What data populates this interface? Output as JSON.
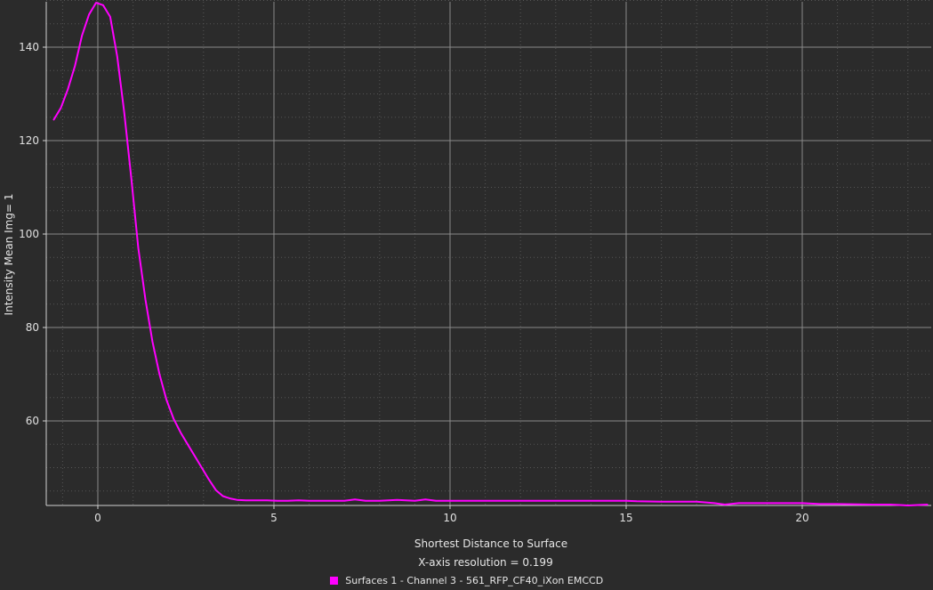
{
  "colors": {
    "background": "#2b2b2b",
    "series": "#ff00ff",
    "grid_major": "#8a8a8a",
    "grid_minor": "#555555",
    "text": "#e6e6e6"
  },
  "chart_data": {
    "type": "line",
    "xlabel": "Shortest Distance to Surface",
    "ylabel": "Intensity Mean Img= 1",
    "subtitle": "X-axis resolution = 0.199",
    "xlim": [
      -1.3,
      23.6
    ],
    "ylim": [
      41.5,
      150
    ],
    "xticks": [
      0,
      5,
      10,
      15,
      20
    ],
    "yticks": [
      60,
      80,
      100,
      120,
      140
    ],
    "grid": true,
    "legend_position": "bottom",
    "series": [
      {
        "name": "Surfaces 1 - Channel 3 - 561_RFP_CF40_iXon EMCCD",
        "color": "#ff00ff",
        "x": [
          -1.25,
          -1.05,
          -0.85,
          -0.65,
          -0.45,
          -0.25,
          -0.05,
          0.15,
          0.35,
          0.55,
          0.75,
          0.95,
          1.15,
          1.35,
          1.55,
          1.75,
          1.95,
          2.15,
          2.35,
          2.55,
          2.75,
          2.95,
          3.15,
          3.35,
          3.55,
          3.75,
          3.95,
          4.2,
          4.5,
          4.8,
          5.1,
          5.4,
          5.7,
          6.0,
          6.5,
          7.0,
          7.3,
          7.6,
          8.0,
          8.5,
          9.0,
          9.3,
          9.6,
          10.0,
          11.0,
          12.0,
          13.0,
          14.0,
          15.0,
          15.3,
          16.0,
          17.0,
          17.5,
          17.8,
          18.2,
          19.0,
          20.0,
          20.5,
          21.0,
          22.0,
          22.5,
          23.0,
          23.55
        ],
        "y": [
          124.5,
          127.0,
          131.0,
          136.0,
          142.5,
          147.0,
          149.5,
          149.0,
          146.5,
          138.0,
          126.0,
          112.0,
          97.0,
          86.0,
          77.0,
          70.0,
          64.5,
          60.5,
          57.5,
          55.0,
          52.5,
          50.0,
          47.5,
          45.2,
          43.9,
          43.4,
          43.1,
          43.0,
          43.0,
          43.0,
          42.9,
          42.9,
          43.0,
          42.9,
          42.9,
          42.9,
          43.2,
          42.9,
          42.9,
          43.1,
          42.9,
          43.2,
          42.9,
          42.9,
          42.9,
          42.9,
          42.9,
          42.9,
          42.9,
          42.8,
          42.7,
          42.7,
          42.4,
          42.1,
          42.4,
          42.4,
          42.4,
          42.2,
          42.2,
          42.1,
          42.1,
          41.9,
          42.1
        ]
      }
    ]
  }
}
